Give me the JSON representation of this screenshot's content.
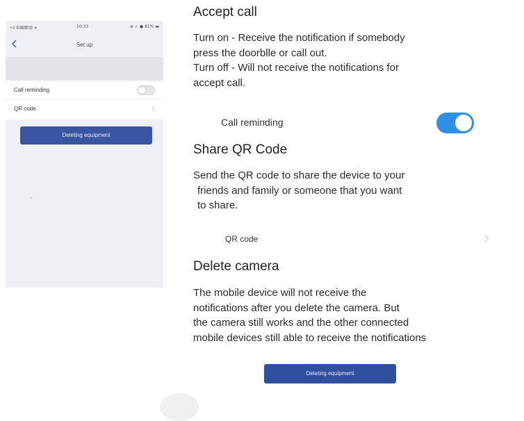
{
  "phone": {
    "status_left": "•ıl 中国移动 ✦",
    "status_time": "10:33",
    "status_right": "⊕ ✓ ● 81% ▬",
    "nav_title": "Set up",
    "rows": [
      {
        "label": "Call reminding",
        "control": "toggle",
        "toggle_on": false
      },
      {
        "label": "QR code",
        "control": "chevron"
      }
    ],
    "button_label": "Deleting equipment",
    "colors": {
      "button": "#3a56a3",
      "background": "#eef0f6"
    }
  },
  "manual": {
    "accept": {
      "heading": "Accept call",
      "lines": [
        "Turn on - Receive the notification if somebody",
        "press the doorblle or call out.",
        "Turn off - Will not receive the notifications for",
        "accept call."
      ],
      "item_label": "Call reminding",
      "toggle_on": true,
      "toggle_color": "#2f8fe0"
    },
    "share": {
      "heading": "Share QR Code",
      "lines": [
        "Send the QR code to share the device to your",
        "friends and family or someone that you want",
        "to share."
      ],
      "item_label": "QR code"
    },
    "delete": {
      "heading": "Delete camera",
      "lines": [
        "The mobile device will not receive the",
        "notifications after you delete the camera. But",
        "the camera still works and the other connected",
        "mobile devices still able to receive the notifications"
      ],
      "button_label": "Deleting equipment",
      "button_color": "#2f4f9f"
    }
  }
}
